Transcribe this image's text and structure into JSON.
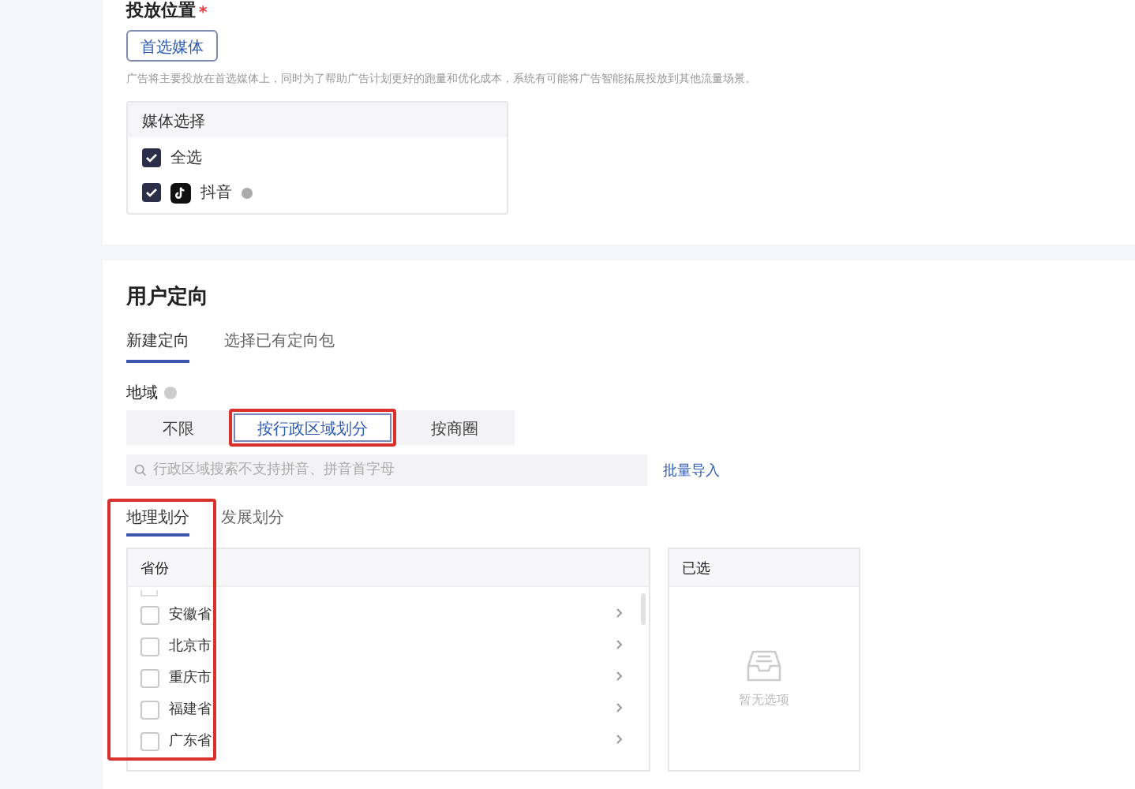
{
  "placement": {
    "label": "投放位置",
    "required_mark": "*",
    "button": "首选媒体",
    "description": "广告将主要投放在首选媒体上，同时为了帮助广告计划更好的跑量和优化成本，系统有可能将广告智能拓展投放到其他流量场景。",
    "media_panel": {
      "title": "媒体选择",
      "options": [
        {
          "kind": "plain",
          "label": "全选",
          "checked": true
        },
        {
          "kind": "app",
          "label": "抖音",
          "checked": true
        }
      ]
    }
  },
  "targeting": {
    "title": "用户定向",
    "tabs": [
      {
        "label": "新建定向",
        "selected": true
      },
      {
        "label": "选择已有定向包",
        "selected": false
      }
    ],
    "region_label": "地域",
    "segments": [
      {
        "label": "不限",
        "selected": false,
        "highlighted": false
      },
      {
        "label": "按行政区域划分",
        "selected": true,
        "highlighted": true
      },
      {
        "label": "按商圈",
        "selected": false,
        "highlighted": false
      }
    ],
    "search": {
      "placeholder": "行政区域搜索不支持拼音、拼音首字母"
    },
    "batch_import": "批量导入",
    "subtabs": [
      {
        "label": "地理划分",
        "selected": true
      },
      {
        "label": "发展划分",
        "selected": false
      }
    ],
    "province_column_highlighted": true,
    "provinces": {
      "title": "省份",
      "items": [
        {
          "label": "安徽省",
          "checked": false
        },
        {
          "label": "北京市",
          "checked": false
        },
        {
          "label": "重庆市",
          "checked": false
        },
        {
          "label": "福建省",
          "checked": false
        },
        {
          "label": "广东省",
          "checked": false
        }
      ]
    },
    "selected_panel": {
      "title": "已选",
      "empty_text": "暂无选项"
    }
  }
}
